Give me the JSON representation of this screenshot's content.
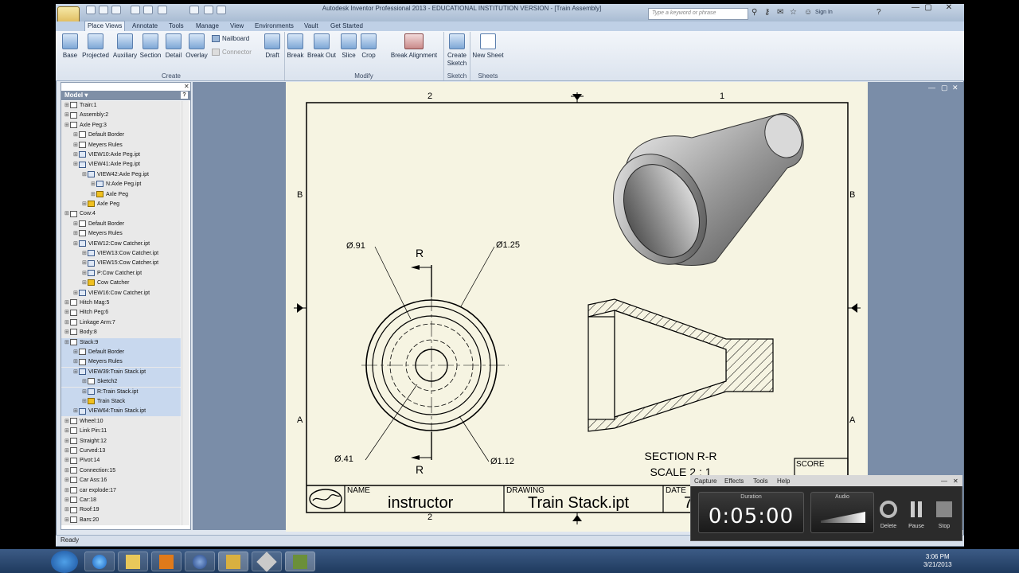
{
  "window": {
    "title": "Autodesk Inventor Professional 2013 - EDUCATIONAL INSTITUTION VERSION - [Train Assembly]",
    "search_placeholder": "Type a keyword or phrase",
    "sign_in": "Sign In",
    "minimize_glyph": "—",
    "restore_glyph": "▢",
    "close_glyph": "✕"
  },
  "tabs": [
    "Place Views",
    "Annotate",
    "Tools",
    "Manage",
    "View",
    "Environments",
    "Vault",
    "Get Started"
  ],
  "ribbon": {
    "create_buttons": [
      "Base",
      "Projected",
      "Auxiliary",
      "Section",
      "Detail",
      "Overlay"
    ],
    "nailboard": "Nailboard",
    "connector": "Connector",
    "draft": "Draft",
    "modify_buttons": [
      "Break",
      "Break Out",
      "Slice",
      "Crop"
    ],
    "break_alignment": "Break Alignment",
    "create_sketch": "Create Sketch",
    "new_sheet": "New Sheet",
    "panels": {
      "create": "Create",
      "modify": "Modify",
      "sketch": "Sketch",
      "sheets": "Sheets"
    }
  },
  "browser": {
    "header": "Model ▾",
    "help": "?",
    "nodes": [
      {
        "label": "Train:1",
        "indent": 0,
        "kind": "sheet"
      },
      {
        "label": "Assembly:2",
        "indent": 0,
        "kind": "sheet"
      },
      {
        "label": "Axle Peg:3",
        "indent": 0,
        "kind": "sheet"
      },
      {
        "label": "Default Border",
        "indent": 1,
        "kind": "sheet"
      },
      {
        "label": "Meyers Rules",
        "indent": 1,
        "kind": "sheet"
      },
      {
        "label": "VIEW10:Axle Peg.ipt",
        "indent": 1,
        "kind": "view"
      },
      {
        "label": "VIEW41:Axle Peg.ipt",
        "indent": 1,
        "kind": "view"
      },
      {
        "label": "VIEW42:Axle Peg.ipt",
        "indent": 2,
        "kind": "view"
      },
      {
        "label": "N:Axle Peg.ipt",
        "indent": 3,
        "kind": "view"
      },
      {
        "label": "Axle Peg",
        "indent": 3,
        "kind": "part"
      },
      {
        "label": "Axle Peg",
        "indent": 2,
        "kind": "part"
      },
      {
        "label": "Cow:4",
        "indent": 0,
        "kind": "sheet"
      },
      {
        "label": "Default Border",
        "indent": 1,
        "kind": "sheet"
      },
      {
        "label": "Meyers Rules",
        "indent": 1,
        "kind": "sheet"
      },
      {
        "label": "VIEW12:Cow Catcher.ipt",
        "indent": 1,
        "kind": "view"
      },
      {
        "label": "VIEW13:Cow Catcher.ipt",
        "indent": 2,
        "kind": "view"
      },
      {
        "label": "VIEW15:Cow Catcher.ipt",
        "indent": 2,
        "kind": "view"
      },
      {
        "label": "P:Cow Catcher.ipt",
        "indent": 2,
        "kind": "view"
      },
      {
        "label": "Cow Catcher",
        "indent": 2,
        "kind": "part"
      },
      {
        "label": "VIEW16:Cow Catcher.ipt",
        "indent": 1,
        "kind": "view"
      },
      {
        "label": "Hitch Mag:5",
        "indent": 0,
        "kind": "sheet"
      },
      {
        "label": "Hitch Peg:6",
        "indent": 0,
        "kind": "sheet"
      },
      {
        "label": "Linkage Arm:7",
        "indent": 0,
        "kind": "sheet"
      },
      {
        "label": "Body:8",
        "indent": 0,
        "kind": "sheet"
      },
      {
        "label": "Stack:9",
        "indent": 0,
        "kind": "sheet",
        "selected": true
      },
      {
        "label": "Default Border",
        "indent": 1,
        "kind": "sheet",
        "selected": true
      },
      {
        "label": "Meyers Rules",
        "indent": 1,
        "kind": "sheet",
        "selected": true
      },
      {
        "label": "VIEW39:Train Stack.ipt",
        "indent": 1,
        "kind": "view",
        "selected": true
      },
      {
        "label": "Sketch2",
        "indent": 2,
        "kind": "sheet",
        "selected": true
      },
      {
        "label": "R:Train Stack.ipt",
        "indent": 2,
        "kind": "view",
        "selected": true
      },
      {
        "label": "Train Stack",
        "indent": 2,
        "kind": "part",
        "selected": true
      },
      {
        "label": "VIEW64:Train Stack.ipt",
        "indent": 1,
        "kind": "view",
        "selected": true
      },
      {
        "label": "Wheel:10",
        "indent": 0,
        "kind": "sheet"
      },
      {
        "label": "Link Pin:11",
        "indent": 0,
        "kind": "sheet"
      },
      {
        "label": "Straight:12",
        "indent": 0,
        "kind": "sheet"
      },
      {
        "label": "Curved:13",
        "indent": 0,
        "kind": "sheet"
      },
      {
        "label": "Pivot:14",
        "indent": 0,
        "kind": "sheet"
      },
      {
        "label": "Connection:15",
        "indent": 0,
        "kind": "sheet"
      },
      {
        "label": "Car Ass:16",
        "indent": 0,
        "kind": "sheet"
      },
      {
        "label": "car explode:17",
        "indent": 0,
        "kind": "sheet"
      },
      {
        "label": "Car:18",
        "indent": 0,
        "kind": "sheet"
      },
      {
        "label": "Roof:19",
        "indent": 0,
        "kind": "sheet"
      },
      {
        "label": "Bars:20",
        "indent": 0,
        "kind": "sheet"
      }
    ]
  },
  "drawing": {
    "zone_top_left": "2",
    "zone_top_right": "1",
    "zone_row_b": "B",
    "zone_row_a": "A",
    "zone_bottom": "2",
    "section_letter": "R",
    "dim_91": "Ø.91",
    "dim_125": "Ø1.25",
    "dim_41": "Ø.41",
    "dim_112": "Ø1.12",
    "section_title": "SECTION R-R",
    "section_scale": "SCALE 2 : 1",
    "score_label": "SCORE",
    "name_label": "NAME",
    "name_value": "instructor",
    "drawing_label": "DRAWING",
    "drawing_value": "Train Stack.ipt",
    "date_label": "DATE",
    "date_value": "7"
  },
  "status": "Ready",
  "recorder": {
    "menu": [
      "Capture",
      "Effects",
      "Tools",
      "Help"
    ],
    "duration_label": "Duration",
    "duration_value": "0:05:00",
    "audio_label": "Audio",
    "buttons": [
      "Delete",
      "Pause",
      "Stop"
    ]
  },
  "taskbar": {
    "time": "3:06 PM",
    "date": "3/21/2013"
  },
  "colors": {
    "sheet": "#f6f4e2",
    "graphics_bg": "#7a8da8",
    "selection": "#c8d8ee"
  }
}
